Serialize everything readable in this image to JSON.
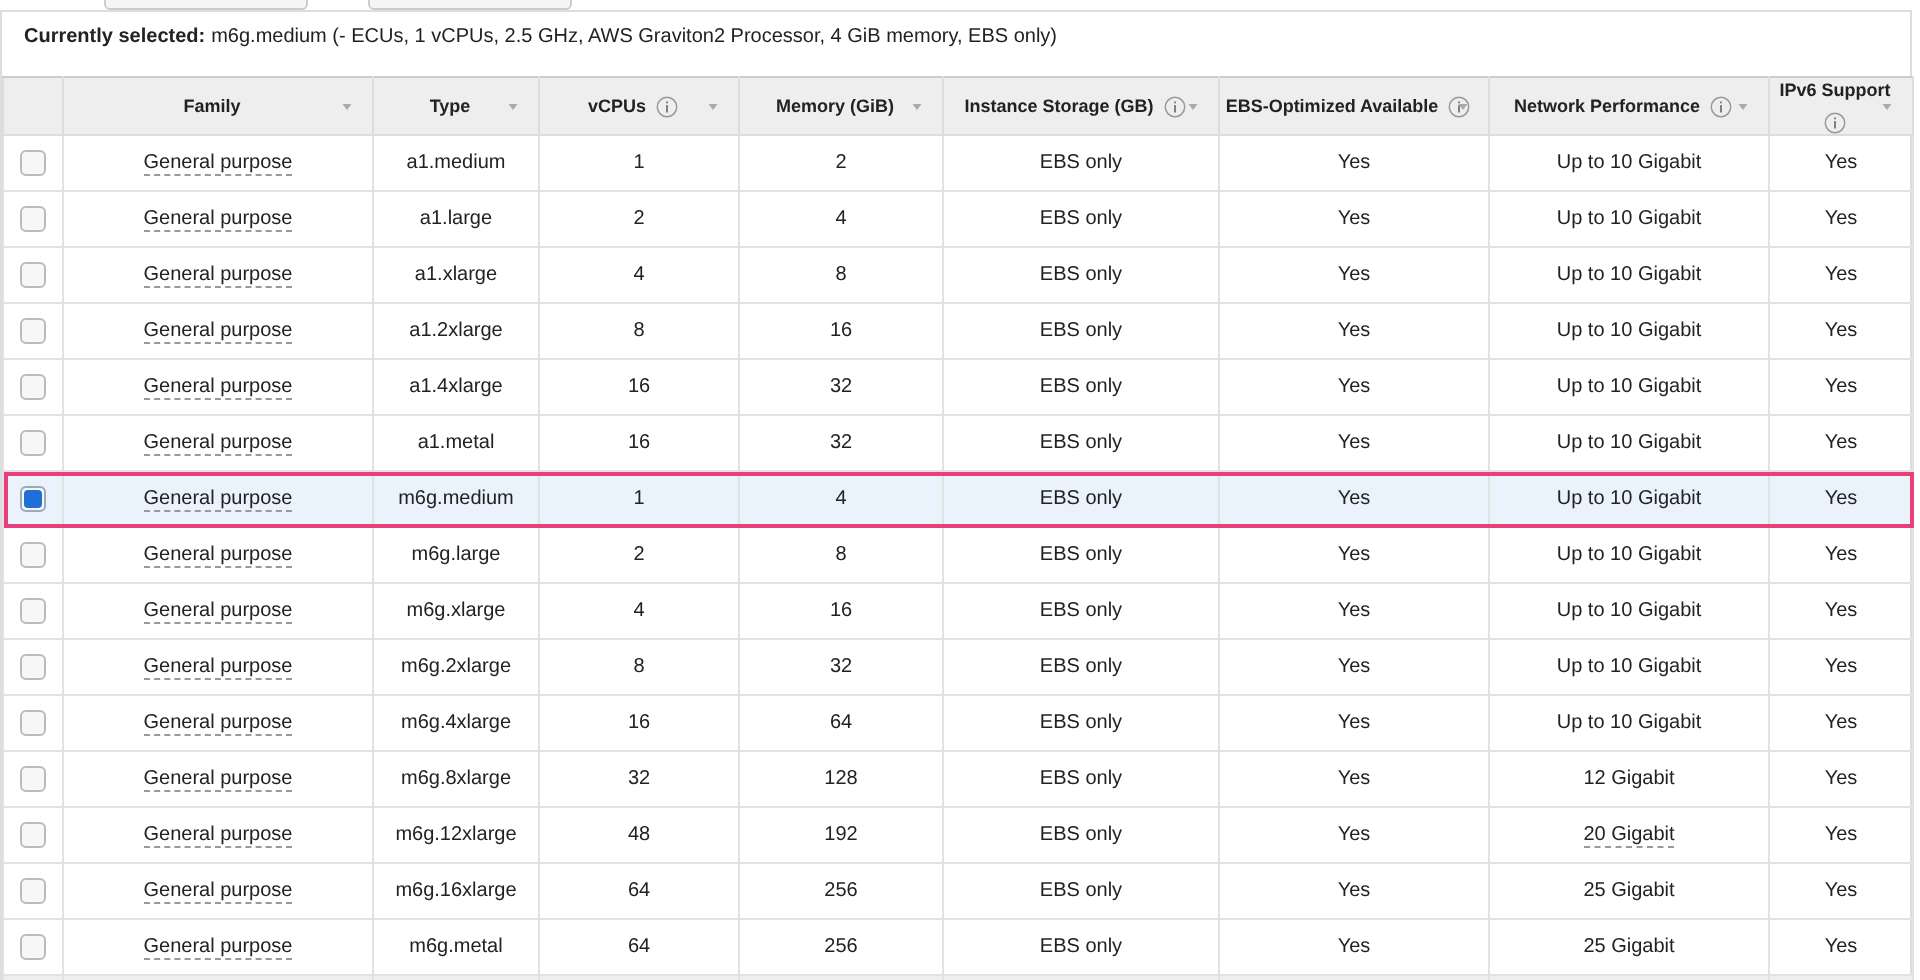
{
  "summary": {
    "label": "Currently selected:",
    "value": "m6g.medium (- ECUs, 1 vCPUs, 2.5 GHz, AWS Graviton2 Processor, 4 GiB memory, EBS only)"
  },
  "table": {
    "columns": [
      {
        "label": "Family",
        "info": false
      },
      {
        "label": "Type",
        "info": false
      },
      {
        "label": "vCPUs",
        "info": true
      },
      {
        "label": "Memory (GiB)",
        "info": false
      },
      {
        "label": "Instance Storage (GB)",
        "info": true
      },
      {
        "label": "EBS-Optimized Available",
        "info": true
      },
      {
        "label": "Network Performance",
        "info": true
      },
      {
        "label": "IPv6 Support",
        "info": true
      }
    ],
    "rows": [
      {
        "selected": false,
        "family": "General purpose",
        "type": "a1.medium",
        "vcpus": "1",
        "memory": "2",
        "storage": "EBS only",
        "ebs": "Yes",
        "network": "Up to 10 Gigabit",
        "network_dotted": false,
        "ipv6": "Yes"
      },
      {
        "selected": false,
        "family": "General purpose",
        "type": "a1.large",
        "vcpus": "2",
        "memory": "4",
        "storage": "EBS only",
        "ebs": "Yes",
        "network": "Up to 10 Gigabit",
        "network_dotted": false,
        "ipv6": "Yes"
      },
      {
        "selected": false,
        "family": "General purpose",
        "type": "a1.xlarge",
        "vcpus": "4",
        "memory": "8",
        "storage": "EBS only",
        "ebs": "Yes",
        "network": "Up to 10 Gigabit",
        "network_dotted": false,
        "ipv6": "Yes"
      },
      {
        "selected": false,
        "family": "General purpose",
        "type": "a1.2xlarge",
        "vcpus": "8",
        "memory": "16",
        "storage": "EBS only",
        "ebs": "Yes",
        "network": "Up to 10 Gigabit",
        "network_dotted": false,
        "ipv6": "Yes"
      },
      {
        "selected": false,
        "family": "General purpose",
        "type": "a1.4xlarge",
        "vcpus": "16",
        "memory": "32",
        "storage": "EBS only",
        "ebs": "Yes",
        "network": "Up to 10 Gigabit",
        "network_dotted": false,
        "ipv6": "Yes"
      },
      {
        "selected": false,
        "family": "General purpose",
        "type": "a1.metal",
        "vcpus": "16",
        "memory": "32",
        "storage": "EBS only",
        "ebs": "Yes",
        "network": "Up to 10 Gigabit",
        "network_dotted": false,
        "ipv6": "Yes"
      },
      {
        "selected": true,
        "family": "General purpose",
        "type": "m6g.medium",
        "vcpus": "1",
        "memory": "4",
        "storage": "EBS only",
        "ebs": "Yes",
        "network": "Up to 10 Gigabit",
        "network_dotted": false,
        "ipv6": "Yes"
      },
      {
        "selected": false,
        "family": "General purpose",
        "type": "m6g.large",
        "vcpus": "2",
        "memory": "8",
        "storage": "EBS only",
        "ebs": "Yes",
        "network": "Up to 10 Gigabit",
        "network_dotted": false,
        "ipv6": "Yes"
      },
      {
        "selected": false,
        "family": "General purpose",
        "type": "m6g.xlarge",
        "vcpus": "4",
        "memory": "16",
        "storage": "EBS only",
        "ebs": "Yes",
        "network": "Up to 10 Gigabit",
        "network_dotted": false,
        "ipv6": "Yes"
      },
      {
        "selected": false,
        "family": "General purpose",
        "type": "m6g.2xlarge",
        "vcpus": "8",
        "memory": "32",
        "storage": "EBS only",
        "ebs": "Yes",
        "network": "Up to 10 Gigabit",
        "network_dotted": false,
        "ipv6": "Yes"
      },
      {
        "selected": false,
        "family": "General purpose",
        "type": "m6g.4xlarge",
        "vcpus": "16",
        "memory": "64",
        "storage": "EBS only",
        "ebs": "Yes",
        "network": "Up to 10 Gigabit",
        "network_dotted": false,
        "ipv6": "Yes"
      },
      {
        "selected": false,
        "family": "General purpose",
        "type": "m6g.8xlarge",
        "vcpus": "32",
        "memory": "128",
        "storage": "EBS only",
        "ebs": "Yes",
        "network": "12 Gigabit",
        "network_dotted": false,
        "ipv6": "Yes"
      },
      {
        "selected": false,
        "family": "General purpose",
        "type": "m6g.12xlarge",
        "vcpus": "48",
        "memory": "192",
        "storage": "EBS only",
        "ebs": "Yes",
        "network": "20 Gigabit",
        "network_dotted": true,
        "ipv6": "Yes"
      },
      {
        "selected": false,
        "family": "General purpose",
        "type": "m6g.16xlarge",
        "vcpus": "64",
        "memory": "256",
        "storage": "EBS only",
        "ebs": "Yes",
        "network": "25 Gigabit",
        "network_dotted": false,
        "ipv6": "Yes"
      },
      {
        "selected": false,
        "family": "General purpose",
        "type": "m6g.metal",
        "vcpus": "64",
        "memory": "256",
        "storage": "EBS only",
        "ebs": "Yes",
        "network": "25 Gigabit",
        "network_dotted": false,
        "ipv6": "Yes"
      }
    ]
  }
}
